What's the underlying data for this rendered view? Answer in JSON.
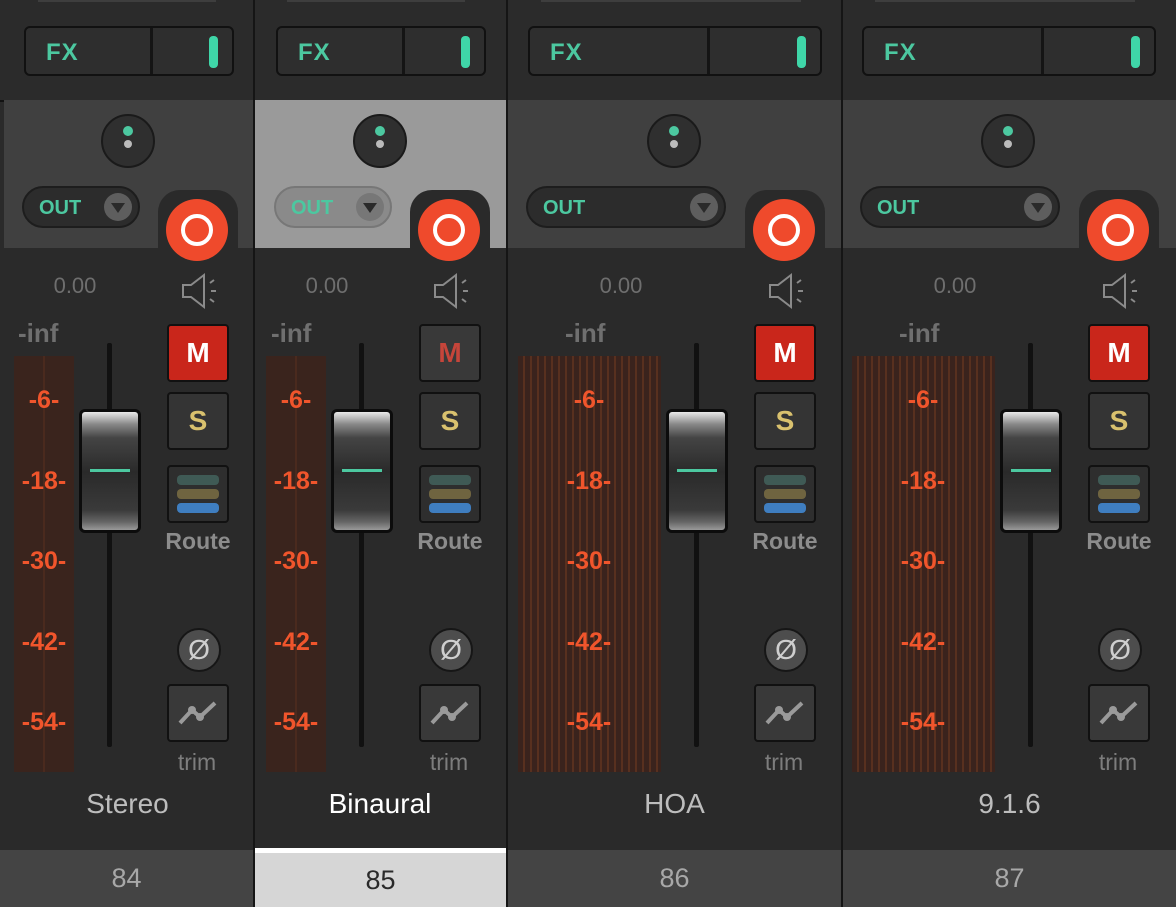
{
  "strips": [
    {
      "fx_label": "FX",
      "out_label": "OUT",
      "volume": "0.00",
      "inf_label": "-inf",
      "scale": [
        "-6-",
        "-18-",
        "-30-",
        "-42-",
        "-54-"
      ],
      "mute_label": "M",
      "solo_label": "S",
      "route_label": "Route",
      "phase_symbol": "Ø",
      "trim_label": "trim",
      "name": "Stereo",
      "number": "84",
      "selected": false,
      "muted": true
    },
    {
      "fx_label": "FX",
      "out_label": "OUT",
      "volume": "0.00",
      "inf_label": "-inf",
      "scale": [
        "-6-",
        "-18-",
        "-30-",
        "-42-",
        "-54-"
      ],
      "mute_label": "M",
      "solo_label": "S",
      "route_label": "Route",
      "phase_symbol": "Ø",
      "trim_label": "trim",
      "name": "Binaural",
      "number": "85",
      "selected": true,
      "muted": false
    },
    {
      "fx_label": "FX",
      "out_label": "OUT",
      "volume": "0.00",
      "inf_label": "-inf",
      "scale": [
        "-6-",
        "-18-",
        "-30-",
        "-42-",
        "-54-"
      ],
      "mute_label": "M",
      "solo_label": "S",
      "route_label": "Route",
      "phase_symbol": "Ø",
      "trim_label": "trim",
      "name": "HOA",
      "number": "86",
      "selected": false,
      "muted": true
    },
    {
      "fx_label": "FX",
      "out_label": "OUT",
      "volume": "0.00",
      "inf_label": "-inf",
      "scale": [
        "-6-",
        "-18-",
        "-30-",
        "-42-",
        "-54-"
      ],
      "mute_label": "M",
      "solo_label": "S",
      "route_label": "Route",
      "phase_symbol": "Ø",
      "trim_label": "trim",
      "name": "9.1.6",
      "number": "87",
      "selected": false,
      "muted": true
    }
  ],
  "colors": {
    "accent": "#4cc8a0",
    "record": "#ef4a2c",
    "mute": "#c9261b",
    "solo_text": "#d9c16e",
    "meter_scale": "#f0552c",
    "route_bars": [
      "#3f5a55",
      "#6f6440",
      "#3f7ec0"
    ]
  }
}
